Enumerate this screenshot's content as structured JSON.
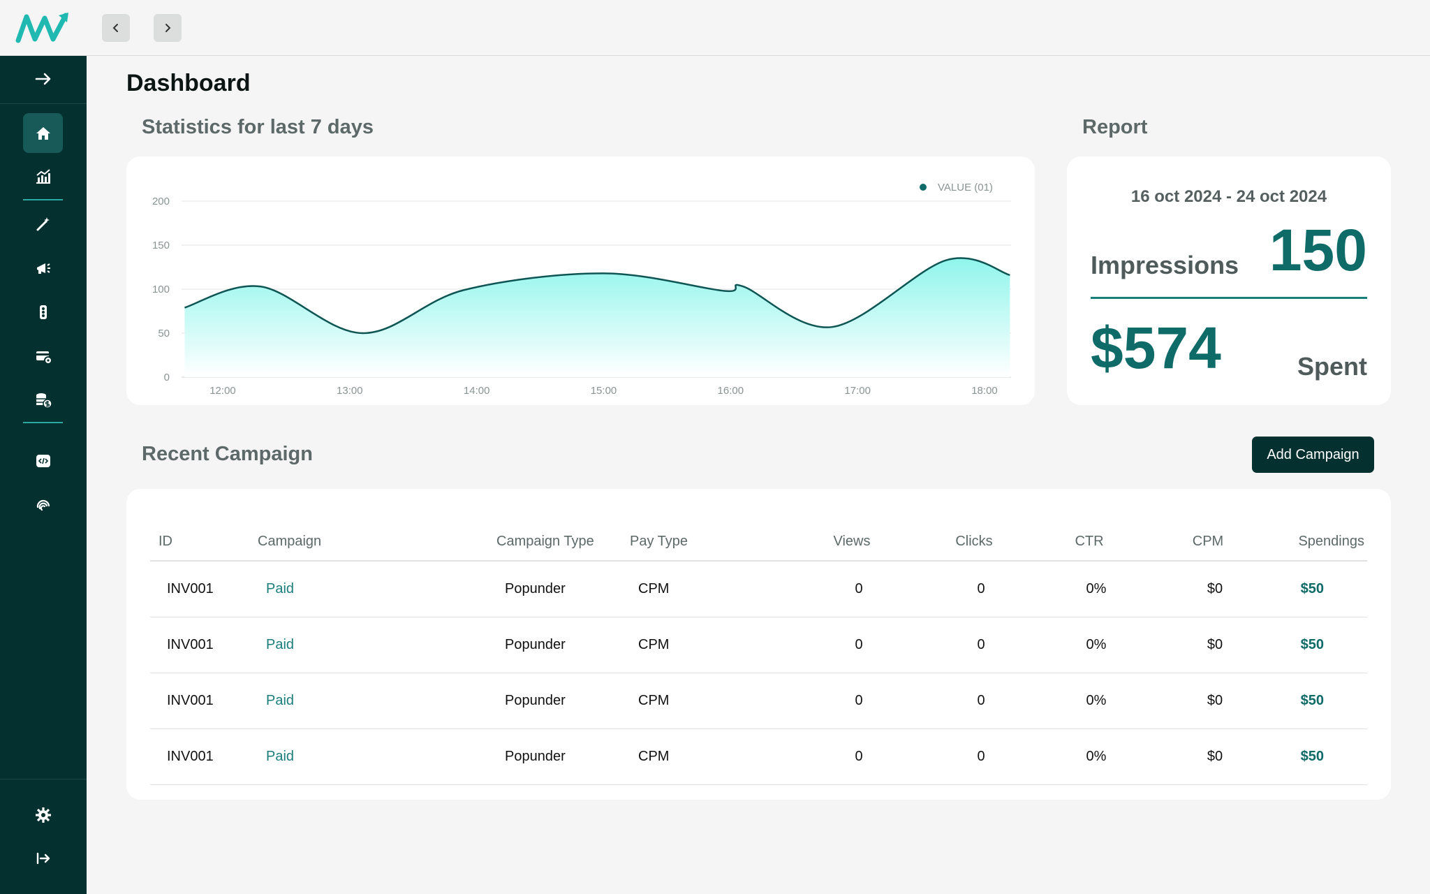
{
  "page_title": "Dashboard",
  "stats": {
    "title": "Statistics for last 7 days"
  },
  "chart_data": {
    "type": "area",
    "x": [
      "12:00",
      "13:00",
      "14:00",
      "15:00",
      "16:00",
      "17:00",
      "18:00"
    ],
    "series": [
      {
        "name": "VALUE (01)",
        "points": [
          [
            11.7,
            79
          ],
          [
            12.3,
            103
          ],
          [
            13.1,
            50
          ],
          [
            13.9,
            99
          ],
          [
            15.0,
            118
          ],
          [
            15.95,
            98
          ],
          [
            16.1,
            103
          ],
          [
            16.8,
            57
          ],
          [
            17.7,
            133
          ],
          [
            18.2,
            116
          ]
        ]
      }
    ],
    "ylim": [
      0,
      200
    ],
    "yticks": [
      0,
      50,
      100,
      150,
      200
    ],
    "grid": true,
    "legend": "top-right",
    "colors": {
      "line": "#0e5553",
      "fill_top": "#8ff5ec",
      "fill_bottom": "#ffffff",
      "legend_dot": "#0e6b68"
    }
  },
  "report": {
    "title": "Report",
    "date_range": "16 oct 2024 - 24 oct 2024",
    "impressions_label": "Impressions",
    "impressions_value": "150",
    "spent_value": "$574",
    "spent_label": "Spent"
  },
  "recent": {
    "title": "Recent Campaign",
    "add_button": "Add Campaign",
    "columns": [
      "ID",
      "Campaign",
      "Campaign Type",
      "Pay Type",
      "Views",
      "Clicks",
      "CTR",
      "CPM",
      "Spendings"
    ],
    "rows": [
      [
        "INV001",
        "Paid",
        "Popunder",
        "CPM",
        "0",
        "0",
        "0%",
        "$0",
        "$50"
      ],
      [
        "INV001",
        "Paid",
        "Popunder",
        "CPM",
        "0",
        "0",
        "0%",
        "$0",
        "$50"
      ],
      [
        "INV001",
        "Paid",
        "Popunder",
        "CPM",
        "0",
        "0",
        "0%",
        "$0",
        "$50"
      ],
      [
        "INV001",
        "Paid",
        "Popunder",
        "CPM",
        "0",
        "0",
        "0%",
        "$0",
        "$50"
      ]
    ]
  },
  "sidebar": {
    "icons": [
      "collapse-arrow-icon",
      "home-icon",
      "analytics-icon",
      "magic-wand-icon",
      "megaphone-icon",
      "traffic-light-icon",
      "card-settings-icon",
      "coins-dollar-icon",
      "code-icon",
      "fingerprint-icon",
      "settings-icon",
      "logout-icon"
    ]
  },
  "colors": {
    "accent": "#0e6b68",
    "sidebar": "#04302f",
    "logo": "#1fb9b2"
  }
}
